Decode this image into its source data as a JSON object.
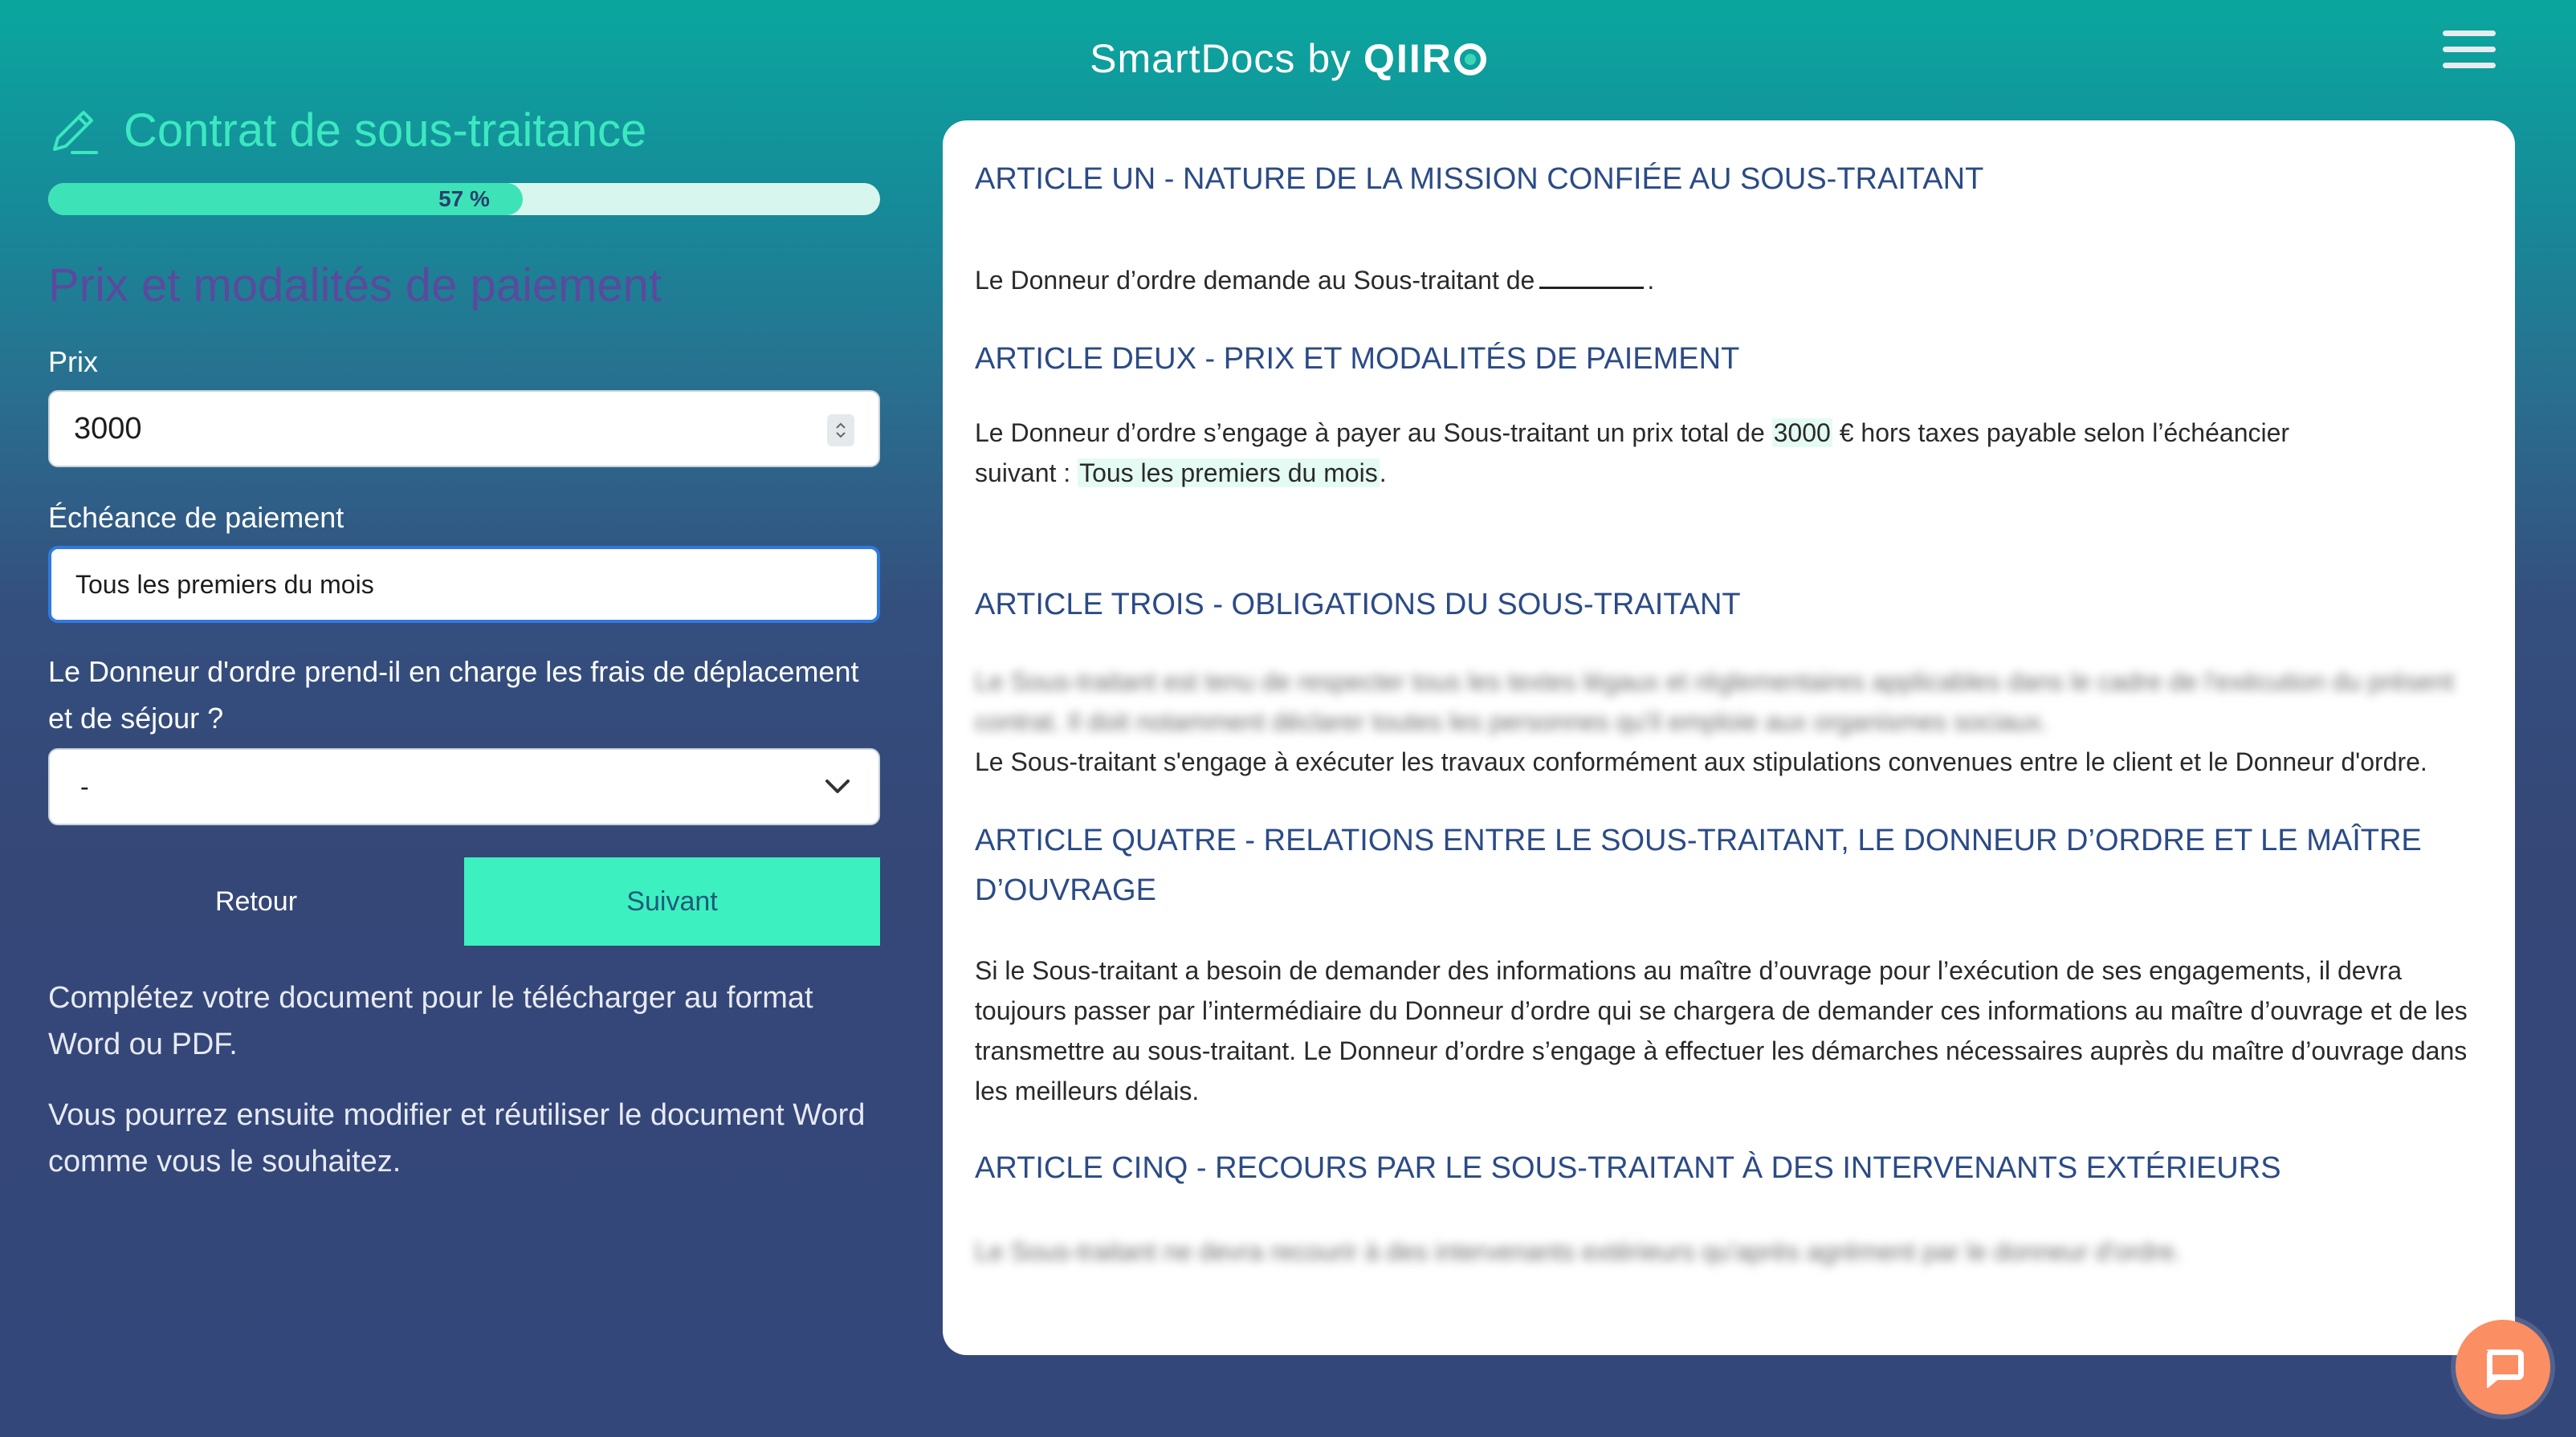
{
  "header": {
    "brand_name": "SmartDocs",
    "brand_by": "by",
    "brand_logo": "QIIR",
    "menu_icon": "hamburger-icon"
  },
  "form": {
    "doc_title": "Contrat de sous-traitance",
    "progress_percent": 57,
    "progress_label": "57 %",
    "section_title": "Prix et modalités de paiement",
    "price_label": "Prix",
    "price_value": "3000",
    "due_label": "Échéance de paiement",
    "due_value": "Tous les premiers du mois",
    "travel_question": "Le Donneur d'ordre prend-il en charge les frais de déplacement et de séjour ?",
    "travel_value": "-",
    "back_label": "Retour",
    "next_label": "Suivant",
    "info_1": "Complétez votre document pour le télécharger au format Word ou PDF.",
    "info_2": "Vous pourrez ensuite modifier et réutiliser le document Word comme vous le souhaitez."
  },
  "document": {
    "a1_title": "ARTICLE UN - NATURE DE LA MISSION CONFIÉE AU SOUS-TRAITANT",
    "a1_text": "Le Donneur d’ordre demande au Sous-traitant de",
    "a1_end": ".",
    "a2_title": "ARTICLE DEUX - PRIX ET MODALITÉS DE PAIEMENT",
    "a2_text_1": "Le Donneur d’ordre s’engage à payer au Sous-traitant un prix total de",
    "a2_price": "3000",
    "a2_text_2": "€ hors taxes payable selon l’échéancier suivant :",
    "a2_due": "Tous les premiers du mois",
    "a2_end": ".",
    "a3_title": "ARTICLE TROIS - OBLIGATIONS DU SOUS-TRAITANT",
    "a3_blurred": "Le Sous-traitant est tenu de respecter tous les textes légaux et réglementaires applicables dans le cadre de l'exécution du présent contrat. Il doit notamment déclarer toutes les personnes qu'il emploie aux organismes sociaux.",
    "a3_text": "Le Sous-traitant s'engage à exécuter les travaux conformément aux stipulations convenues entre le client et le Donneur d'ordre.",
    "a4_title": "ARTICLE QUATRE - RELATIONS ENTRE LE SOUS-TRAITANT, LE DONNEUR D’ORDRE ET LE MAÎTRE D’OUVRAGE",
    "a4_text": "Si le Sous-traitant a besoin de demander des informations au maître d’ouvrage pour l’exécution de ses engagements, il devra toujours passer par l’intermédiaire du Donneur d’ordre qui se chargera de demander ces informations au maître d’ouvrage et de les transmettre au sous-traitant. Le Donneur d’ordre s’engage à effectuer les démarches nécessaires auprès du maître d’ouvrage dans les meilleurs délais.",
    "a5_title": "ARTICLE CINQ - RECOURS PAR LE SOUS-TRAITANT À DES INTERVENANTS EXTÉRIEURS",
    "a5_blurred": "Le Sous-traitant ne devra recourir à des intervenants extérieurs qu'après agrément par le donneur d'ordre."
  },
  "colors": {
    "accent": "#3ce8c0",
    "next_button": "#3df0bf",
    "doc_heading": "#2b4b86",
    "chat_button": "#fb8e63"
  }
}
